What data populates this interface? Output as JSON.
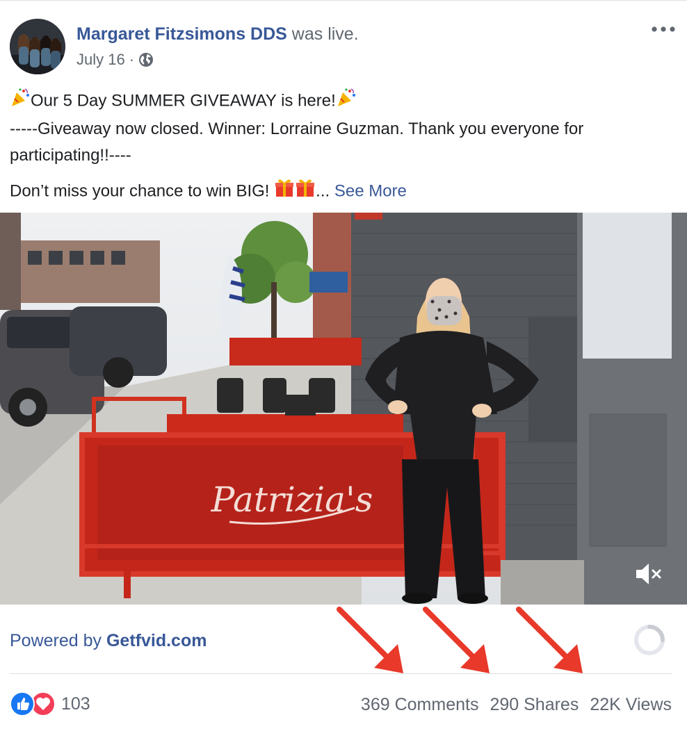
{
  "post": {
    "author": "Margaret Fitzsimons DDS",
    "action": "was live.",
    "date": "July 16",
    "date_separator": "·",
    "audience_icon": "globe-icon",
    "more_icon": "more-options-icon",
    "text": {
      "line1": "Our 5 Day SUMMER GIVEAWAY is here!",
      "line2": "-----Giveaway now closed. Winner: Lorraine Guzman. Thank you everyone for participating!!----",
      "line3": "Don’t miss your chance to win BIG!",
      "ellipsis": "...",
      "see_more": "See More"
    },
    "emoji": {
      "party": "party-popper",
      "gift": "wrapped-gift"
    }
  },
  "video": {
    "sign_text": "Patrizia's",
    "mute_icon": "speaker-muted-icon"
  },
  "footer": {
    "powered_prefix": "Powered by ",
    "powered_brand": "Getfvid.com",
    "reaction_count": "103",
    "comments": "369 Comments",
    "shares": "290 Shares",
    "views": "22K Views"
  },
  "colors": {
    "link": "#385898",
    "muted": "#606770",
    "arrow": "#e8392a",
    "like": "#1877f2",
    "love": "#f33e58"
  }
}
